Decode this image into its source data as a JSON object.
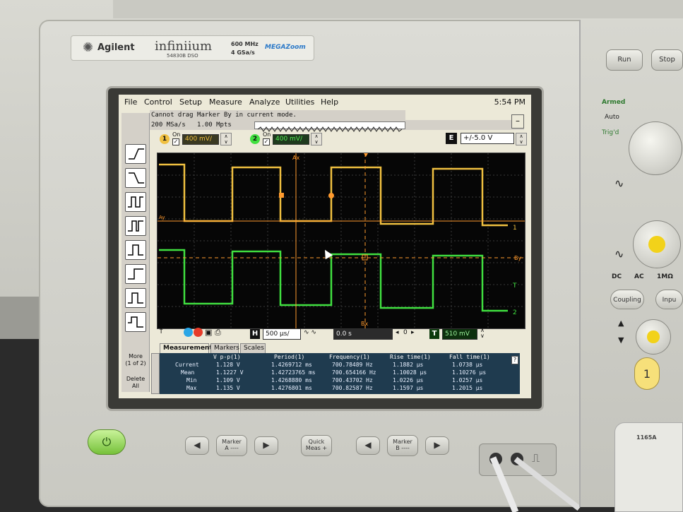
{
  "brand": {
    "maker": "Agilent",
    "product": "infiniium",
    "model": "54830B DSO",
    "spec_bandwidth": "600 MHz",
    "spec_rate": "4 GSa/s",
    "feature": "MEGAZoom"
  },
  "menu": {
    "items": [
      "File",
      "Control",
      "Setup",
      "Measure",
      "Analyze",
      "Utilities",
      "Help"
    ],
    "clock": "5:54 PM"
  },
  "status": {
    "message": "Cannot drag Marker By in current mode.",
    "sample_rate": "200 MSa/s",
    "memory_depth": "1.00 Mpts"
  },
  "channels": [
    {
      "number": "1",
      "on_label": "On",
      "scale": "400 mV/",
      "color": "#f0c040"
    },
    {
      "number": "2",
      "on_label": "On",
      "scale": "400 mV/",
      "color": "#40e040"
    }
  ],
  "offset": {
    "label": "E",
    "value": "+/-5.0 V"
  },
  "toolbar": {
    "more_label": "More",
    "more_page": "(1 of 2)",
    "delete_label": "Delete",
    "delete_sub": "All"
  },
  "timebase": {
    "h_label": "H",
    "scale": "500 µs/",
    "delay": "0.0 s",
    "run_value": "0",
    "trig_label": "T",
    "trig_level": "510 mV"
  },
  "plot_labels": {
    "ax": "Ax",
    "bx": "Bx",
    "ay": "Ay",
    "by": "By",
    "trig": "T",
    "ch1": "1",
    "ch2": "2"
  },
  "tabs": [
    "Measurements",
    "Markers",
    "Scales"
  ],
  "measurements": {
    "headers": [
      "",
      "V p-p(1)",
      "Period(1)",
      "Frequency(1)",
      "Rise time(1)",
      "Fall time(1)"
    ],
    "rows": [
      [
        "Current",
        "1.128 V",
        "1.4269712 ms",
        "700.78489 Hz",
        "1.1882 µs",
        "1.0738 µs"
      ],
      [
        "Mean",
        "1.1227 V",
        "1.42723765 ms",
        "700.654166 Hz",
        "1.10028 µs",
        "1.10276 µs"
      ],
      [
        "Min",
        "1.109 V",
        "1.4268880 ms",
        "700.43702 Hz",
        "1.0226 µs",
        "1.0257 µs"
      ],
      [
        "Max",
        "1.135 V",
        "1.4276801 ms",
        "700.82587 Hz",
        "1.1597 µs",
        "1.2015 µs"
      ]
    ],
    "help": "?"
  },
  "front_panel": {
    "run": "Run",
    "stop": "Stop",
    "armed": "Armed",
    "auto": "Auto",
    "trigd": "Trig'd",
    "dc": "DC",
    "ac": "AC",
    "imp": "1MΩ",
    "coupling": "Coupling",
    "input": "Inpu",
    "channel_badge": "1",
    "marker_a": "Marker",
    "marker_a_sub": "A ----",
    "quick_meas": "Quick",
    "quick_meas_sub": "Meas +",
    "marker_b": "Marker",
    "marker_b_sub": "B ----",
    "probe_label": "1165A"
  }
}
